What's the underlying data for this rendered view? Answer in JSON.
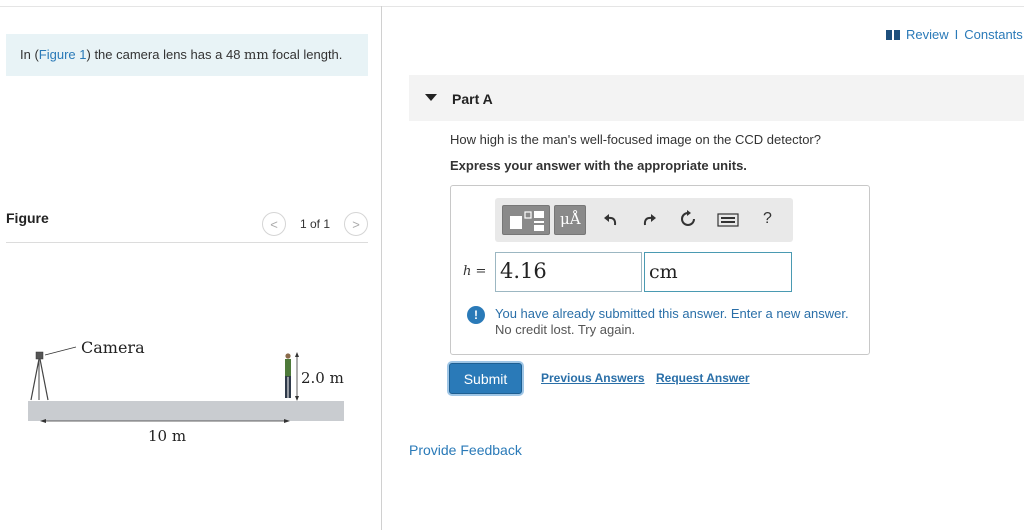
{
  "problem": {
    "prefix": "In (",
    "figure_link": "Figure 1",
    "middle": ") the camera lens has a 48 ",
    "unit": "mm",
    "suffix": " focal length."
  },
  "figure": {
    "title": "Figure",
    "counter": "1 of 1",
    "prev_glyph": "<",
    "next_glyph": ">",
    "camera_label": "Camera",
    "height_label": "2.0 m",
    "distance_label": "10 m"
  },
  "header": {
    "review": "Review",
    "separator": " I ",
    "constants": "Constants"
  },
  "part": {
    "title": "Part A",
    "question": "How high is the man's well-focused image on the CCD detector?",
    "instruction": "Express your answer with the appropriate units."
  },
  "toolbar": {
    "units_label": "μÅ",
    "undo_icon": "undo-icon",
    "redo_icon": "redo-icon",
    "reset_icon": "reset-icon",
    "keyboard_icon": "keyboard-icon",
    "help_label": "?"
  },
  "answer": {
    "variable": "h",
    "equals": " =",
    "value": "4.16",
    "unit": "cm"
  },
  "feedback_msg": {
    "line1": "You have already submitted this answer. Enter a new answer.",
    "line2": "No credit lost. Try again."
  },
  "actions": {
    "submit": "Submit",
    "previous_answers": "Previous Answers",
    "request_answer": "Request Answer",
    "provide_feedback": "Provide Feedback"
  },
  "colors": {
    "accent": "#2a7ab8",
    "problem_bg": "#e8f3f6",
    "part_bg": "#f3f3f3"
  }
}
